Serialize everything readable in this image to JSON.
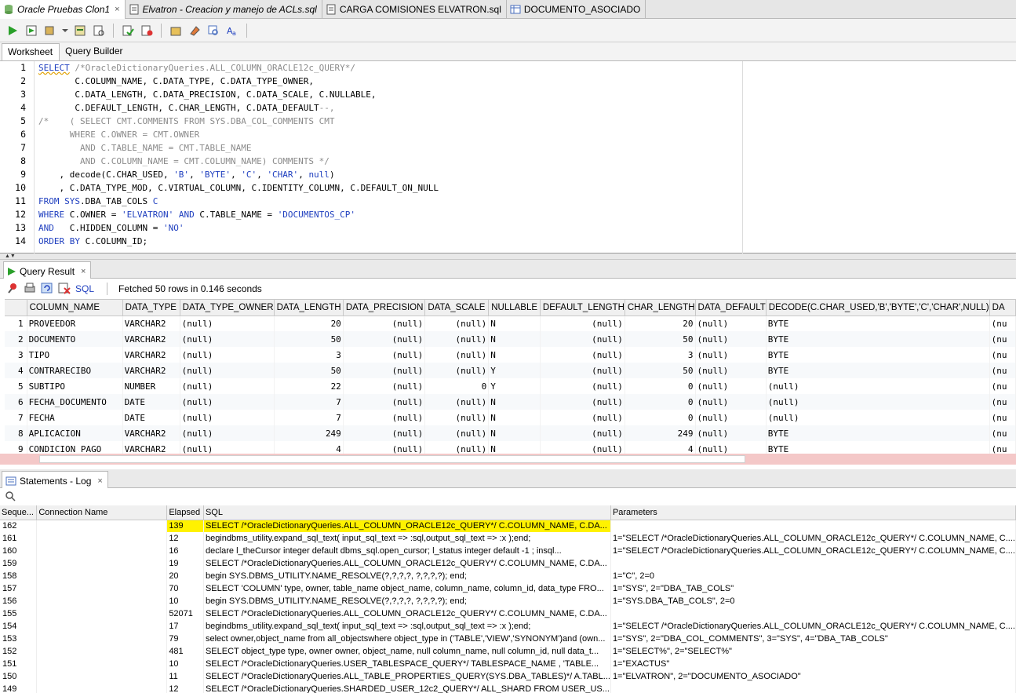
{
  "editor_tabs": [
    {
      "label": "Oracle Pruebas Clon1",
      "italic": true,
      "icon": "database-icon",
      "active": true,
      "close": "×"
    },
    {
      "label": "Elvatron - Creacion y manejo de ACLs.sql",
      "italic": true,
      "icon": "sql-file-icon",
      "active": false,
      "close": ""
    },
    {
      "label": "CARGA COMISIONES ELVATRON.sql",
      "italic": false,
      "icon": "sql-file-icon",
      "active": false,
      "close": ""
    },
    {
      "label": "DOCUMENTO_ASOCIADO",
      "italic": false,
      "icon": "table-icon",
      "active": false,
      "close": ""
    }
  ],
  "worksheet_tabs": [
    "Worksheet",
    "Query Builder"
  ],
  "line_numbers": [
    "1",
    "2",
    "3",
    "4",
    "5",
    "6",
    "7",
    "8",
    "9",
    "10",
    "11",
    "12",
    "13",
    "14"
  ],
  "result_tab": {
    "label": "Query Result",
    "close": "×"
  },
  "result_toolbar": {
    "sql_label": "SQL",
    "status": "Fetched 50 rows in 0.146 seconds"
  },
  "result_columns": [
    "COLUMN_NAME",
    "DATA_TYPE",
    "DATA_TYPE_OWNER",
    "DATA_LENGTH",
    "DATA_PRECISION",
    "DATA_SCALE",
    "NULLABLE",
    "DEFAULT_LENGTH",
    "CHAR_LENGTH",
    "DATA_DEFAULT",
    "DECODE(C.CHAR_USED,'B','BYTE','C','CHAR',NULL)",
    "DA"
  ],
  "result_rows": [
    [
      "1",
      "PROVEEDOR",
      "VARCHAR2",
      "(null)",
      "20",
      "(null)",
      "(null)",
      "N",
      "(null)",
      "20",
      "(null)",
      "BYTE",
      "(nu"
    ],
    [
      "2",
      "DOCUMENTO",
      "VARCHAR2",
      "(null)",
      "50",
      "(null)",
      "(null)",
      "N",
      "(null)",
      "50",
      "(null)",
      "BYTE",
      "(nu"
    ],
    [
      "3",
      "TIPO",
      "VARCHAR2",
      "(null)",
      "3",
      "(null)",
      "(null)",
      "N",
      "(null)",
      "3",
      "(null)",
      "BYTE",
      "(nu"
    ],
    [
      "4",
      "CONTRARECIBO",
      "VARCHAR2",
      "(null)",
      "50",
      "(null)",
      "(null)",
      "Y",
      "(null)",
      "50",
      "(null)",
      "BYTE",
      "(nu"
    ],
    [
      "5",
      "SUBTIPO",
      "NUMBER",
      "(null)",
      "22",
      "(null)",
      "0",
      "Y",
      "(null)",
      "0",
      "(null)",
      "(null)",
      "(nu"
    ],
    [
      "6",
      "FECHA_DOCUMENTO",
      "DATE",
      "(null)",
      "7",
      "(null)",
      "(null)",
      "N",
      "(null)",
      "0",
      "(null)",
      "(null)",
      "(nu"
    ],
    [
      "7",
      "FECHA",
      "DATE",
      "(null)",
      "7",
      "(null)",
      "(null)",
      "N",
      "(null)",
      "0",
      "(null)",
      "(null)",
      "(nu"
    ],
    [
      "8",
      "APLICACION",
      "VARCHAR2",
      "(null)",
      "249",
      "(null)",
      "(null)",
      "N",
      "(null)",
      "249",
      "(null)",
      "BYTE",
      "(nu"
    ],
    [
      "9",
      "CONDICION_PAGO",
      "VARCHAR2",
      "(null)",
      "4",
      "(null)",
      "(null)",
      "N",
      "(null)",
      "4",
      "(null)",
      "BYTE",
      "(nu"
    ]
  ],
  "log_tab": {
    "label": "Statements - Log",
    "close": "×"
  },
  "log_columns": [
    "Seque...",
    "Connection Name",
    "Elapsed",
    "SQL",
    "Parameters"
  ],
  "log_rows": [
    {
      "seq": "162",
      "conn": "",
      "elapsed": "139",
      "sql": "SELECT /*OracleDictionaryQueries.ALL_COLUMN_ORACLE12c_QUERY*/      C.COLUMN_NAME, C.DA...",
      "params": "",
      "highlight": true
    },
    {
      "seq": "161",
      "conn": "",
      "elapsed": "12",
      "sql": "begindbms_utility.expand_sql_text( input_sql_text => :sql,output_sql_text => :x );end;",
      "params": "1=\"SELECT /*OracleDictionaryQueries.ALL_COLUMN_ORACLE12c_QUERY*/       C.COLUMN_NAME, C....",
      "highlight": false
    },
    {
      "seq": "160",
      "conn": "",
      "elapsed": "16",
      "sql": "declare   l_theCursor     integer default dbms_sql.open_cursor;  l_status        integer default -1 ;  insql...",
      "params": "1=\"SELECT /*OracleDictionaryQueries.ALL_COLUMN_ORACLE12c_QUERY*/       C.COLUMN_NAME, C....",
      "highlight": false
    },
    {
      "seq": "159",
      "conn": "",
      "elapsed": "19",
      "sql": "SELECT /*OracleDictionaryQueries.ALL_COLUMN_ORACLE12c_QUERY*/      C.COLUMN_NAME, C.DA...",
      "params": "",
      "highlight": false
    },
    {
      "seq": "158",
      "conn": "",
      "elapsed": "20",
      "sql": "begin SYS.DBMS_UTILITY.NAME_RESOLVE(?,?,?,?, ?,?,?,?); end;",
      "params": "1=\"C\", 2=0",
      "highlight": false
    },
    {
      "seq": "157",
      "conn": "",
      "elapsed": "70",
      "sql": "SELECT 'COLUMN' type, owner, table_name object_name, column_name, column_id, data_type FRO...",
      "params": "1=\"SYS\", 2=\"DBA_TAB_COLS\"",
      "highlight": false
    },
    {
      "seq": "156",
      "conn": "",
      "elapsed": "10",
      "sql": "begin SYS.DBMS_UTILITY.NAME_RESOLVE(?,?,?,?, ?,?,?,?); end;",
      "params": "1=\"SYS.DBA_TAB_COLS\", 2=0",
      "highlight": false
    },
    {
      "seq": "155",
      "conn": "",
      "elapsed": "52071",
      "sql": "SELECT /*OracleDictionaryQueries.ALL_COLUMN_ORACLE12c_QUERY*/      C.COLUMN_NAME, C.DA...",
      "params": "",
      "highlight": false
    },
    {
      "seq": "154",
      "conn": "",
      "elapsed": "17",
      "sql": "begindbms_utility.expand_sql_text( input_sql_text => :sql,output_sql_text => :x );end;",
      "params": "1=\"SELECT /*OracleDictionaryQueries.ALL_COLUMN_ORACLE12c_QUERY*/       C.COLUMN_NAME, C....",
      "highlight": false
    },
    {
      "seq": "153",
      "conn": "",
      "elapsed": "79",
      "sql": "select owner,object_name from all_objectswhere object_type in ('TABLE','VIEW','SYNONYM')and (own...",
      "params": "1=\"SYS\", 2=\"DBA_COL_COMMENTS\", 3=\"SYS\", 4=\"DBA_TAB_COLS\"",
      "highlight": false
    },
    {
      "seq": "152",
      "conn": "",
      "elapsed": "481",
      "sql": "SELECT object_type type, owner  owner, object_name, null column_name, null column_id, null data_t...",
      "params": "1=\"SELECT%\", 2=\"SELECT%\"",
      "highlight": false
    },
    {
      "seq": "151",
      "conn": "",
      "elapsed": "10",
      "sql": "SELECT /*OracleDictionaryQueries.USER_TABLESPACE_QUERY*/      TABLESPACE_NAME ,    'TABLE...",
      "params": "1=\"EXACTUS\"",
      "highlight": false
    },
    {
      "seq": "150",
      "conn": "",
      "elapsed": "11",
      "sql": "SELECT /*OracleDictionaryQueries.ALL_TABLE_PROPERTIES_QUERY(SYS.DBA_TABLES)*/       A.TABL...",
      "params": "1=\"ELVATRON\", 2=\"DOCUMENTO_ASOCIADO\"",
      "highlight": false
    },
    {
      "seq": "149",
      "conn": "",
      "elapsed": "12",
      "sql": "SELECT /*OracleDictionaryQueries.SHARDED_USER_12c2_QUERY*/      ALL_SHARD FROM USER_US...",
      "params": "",
      "highlight": false
    }
  ]
}
